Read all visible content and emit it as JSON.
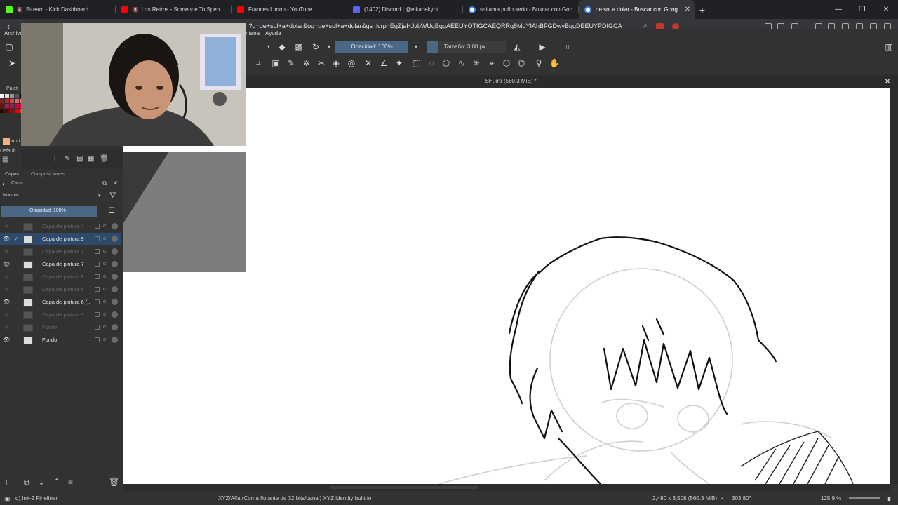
{
  "browser": {
    "tabs": [
      {
        "title": "Stream - Kick Dashboard",
        "icon": "kick-icon",
        "color": "#53fc18",
        "muted": true
      },
      {
        "title": "Los Retros - Someone To Spend T",
        "icon": "youtube-icon",
        "color": "#ff0000",
        "muted": true
      },
      {
        "title": "Frances Limon - YouTube",
        "icon": "youtube-icon",
        "color": "#ff0000"
      },
      {
        "title": "(1402) Discord | @elkanekypt",
        "icon": "discord-icon",
        "color": "#5865f2"
      },
      {
        "title": "saitama puño serio - Buscar con Goo",
        "icon": "google-icon",
        "color": "#ffffff"
      },
      {
        "title": "de sol a dolar - Buscar con Goog",
        "icon": "google-icon",
        "color": "#ffffff",
        "active": true
      }
    ],
    "new_tab": "+",
    "url": "ch?q=de+sol+a+dolar&oq=de+sol+a+dolar&gs_lcrp=EgZjaHJvbWUqBggAEEUYOTIGCAEQRRg8MgYIAhBFGDwyBggDEEUYPDIGCA",
    "window_controls": {
      "minimize": "—",
      "restore": "❐",
      "close": "✕"
    }
  },
  "krita": {
    "menu": {
      "archivo": "Archivo",
      "ventana": "ntana",
      "ayuda": "Ayuda"
    },
    "opacity_label": "Opacidad: 100%",
    "size_label": "Tamaño: 3.00 px",
    "document_title": "SH.kra (560.3 MiB) *",
    "docker": {
      "palette_label": "Palet",
      "default_label": "Default",
      "apply_label": "Apri",
      "layers_tab": "Capas",
      "compositions_tab": "Composiciones",
      "layers_title": "Capa",
      "blend_mode": "Normal",
      "layer_opacity": "Opacidad:  100%"
    },
    "layers": [
      {
        "name": "Capa de pintura 4",
        "visible": false
      },
      {
        "name": "Capa de pintura 9",
        "visible": true,
        "selected": true
      },
      {
        "name": "Capa de pintura 1",
        "visible": false
      },
      {
        "name": "Capa de pintura 7",
        "visible": true
      },
      {
        "name": "Capa de pintura 8",
        "visible": false
      },
      {
        "name": "Capa de pintura 6",
        "visible": false
      },
      {
        "name": "Capa de pintura 6 (...",
        "visible": true
      },
      {
        "name": "Capa de pintura 5",
        "visible": false
      },
      {
        "name": "Fondo",
        "visible": false
      },
      {
        "name": "Fondo",
        "visible": true
      }
    ],
    "status": {
      "brush": "d) Ink-2 Fineliner",
      "color_space": "XYZ/Alfa (Coma flotante de 32 bits/canal)  XYZ identity built-in",
      "image_size": "2,480 x 3,508 (560.3 MiB)",
      "rotation": "303.80°",
      "zoom": "125.9 %"
    }
  }
}
